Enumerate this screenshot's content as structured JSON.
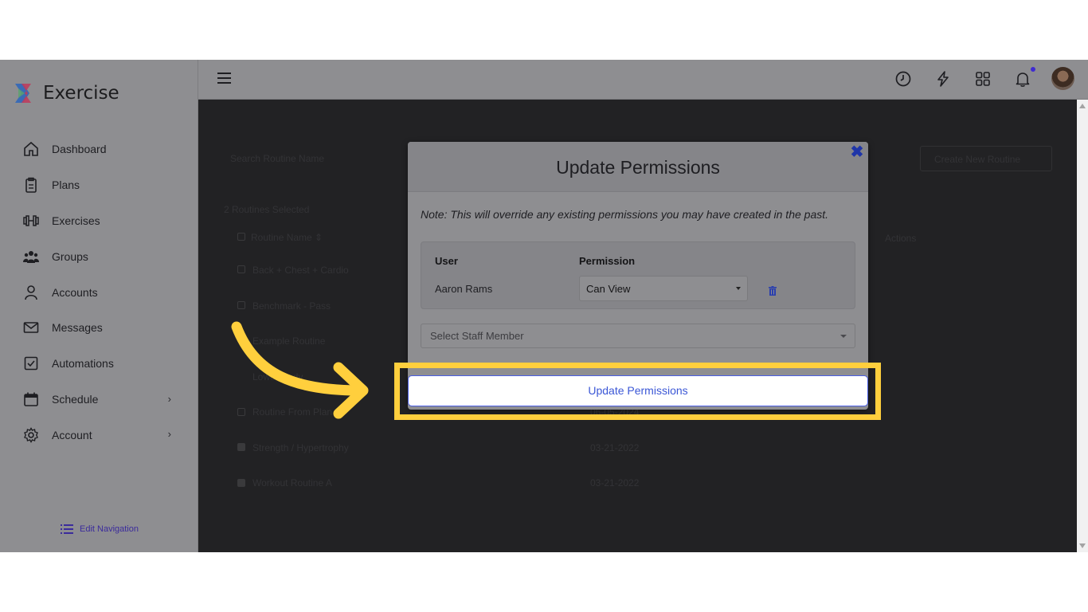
{
  "app": {
    "name": "Exercise"
  },
  "sidebar": {
    "items": [
      {
        "label": "Dashboard",
        "icon": "home-icon"
      },
      {
        "label": "Plans",
        "icon": "clipboard-icon"
      },
      {
        "label": "Exercises",
        "icon": "dumbbell-icon"
      },
      {
        "label": "Groups",
        "icon": "group-icon"
      },
      {
        "label": "Accounts",
        "icon": "person-icon"
      },
      {
        "label": "Messages",
        "icon": "mail-icon"
      },
      {
        "label": "Automations",
        "icon": "checkbox-icon"
      },
      {
        "label": "Schedule",
        "icon": "calendar-icon",
        "has_chevron": true
      },
      {
        "label": "Account",
        "icon": "gear-icon",
        "has_chevron": true
      }
    ],
    "edit_navigation": "Edit Navigation"
  },
  "topbar": {
    "icons": [
      "history-icon",
      "bolt-icon",
      "apps-grid-icon",
      "bell-icon",
      "avatar"
    ],
    "notification_dot_color": "#3f2bd1"
  },
  "background": {
    "search_placeholder": "Search Routine Name",
    "new_button": "Create New Routine",
    "selected_text": "2 Routines Selected",
    "actions_header": "Actions",
    "rows": [
      {
        "name": "Routine Name ⇕",
        "date": "",
        "checked": false
      },
      {
        "name": "Back + Chest + Cardio",
        "date": "",
        "checked": false
      },
      {
        "name": "Benchmark - Pass",
        "date": "",
        "checked": false
      },
      {
        "name": "Example Routine",
        "date": "",
        "checked": false
      },
      {
        "name": "Lower Body",
        "date": "",
        "checked": false
      },
      {
        "name": "Routine From Plan",
        "date": "06-05-2024",
        "checked": false
      },
      {
        "name": "Strength / Hypertrophy",
        "date": "03-21-2022",
        "checked": true
      },
      {
        "name": "Workout Routine A",
        "date": "03-21-2022",
        "checked": true
      }
    ]
  },
  "modal": {
    "title": "Update Permissions",
    "note": "Note: This will override any existing permissions you may have created in the past.",
    "table": {
      "headers": {
        "user": "User",
        "permission": "Permission"
      },
      "rows": [
        {
          "user": "Aaron Rams",
          "permission": "Can View"
        }
      ]
    },
    "staff_select_placeholder": "Select Staff Member",
    "submit_label": "Update Permissions"
  },
  "colors": {
    "highlight": "#ffcf3d",
    "button_text": "#3b57d6",
    "close_icon": "#1f35a8"
  }
}
